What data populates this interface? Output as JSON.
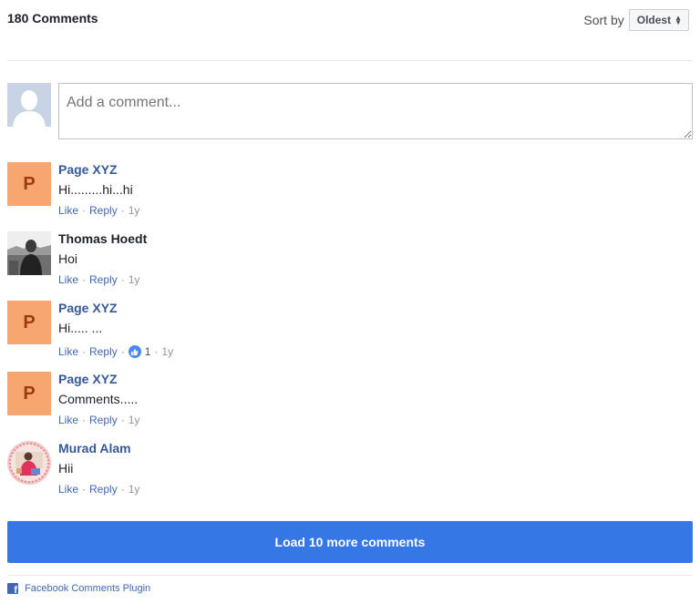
{
  "header": {
    "count_label": "180 Comments",
    "sort_label": "Sort by",
    "sort_value": "Oldest"
  },
  "composer": {
    "placeholder": "Add a comment..."
  },
  "comments": [
    {
      "author": "Page XYZ",
      "avatar_initial": "P",
      "text": "Hi.........hi...hi",
      "like": "Like",
      "reply": "Reply",
      "age": "1y"
    },
    {
      "author": "Thomas Hoedt",
      "text": "Hoi",
      "like": "Like",
      "reply": "Reply",
      "age": "1y"
    },
    {
      "author": "Page XYZ",
      "avatar_initial": "P",
      "text": "Hi..... ...",
      "like": "Like",
      "reply": "Reply",
      "reaction_count": "1",
      "age": "1y"
    },
    {
      "author": "Page XYZ",
      "avatar_initial": "P",
      "text": "Comments.....",
      "like": "Like",
      "reply": "Reply",
      "age": "1y"
    },
    {
      "author": "Murad Alam",
      "text": "Hii",
      "like": "Like",
      "reply": "Reply",
      "age": "1y"
    }
  ],
  "load_more_label": "Load 10 more comments",
  "footer": {
    "plugin_label": "Facebook Comments Plugin",
    "icon": "facebook-icon"
  },
  "colors": {
    "link": "#4267b2",
    "author": "#365899",
    "button": "#3578e5",
    "page_avatar": "#f7a66f"
  }
}
